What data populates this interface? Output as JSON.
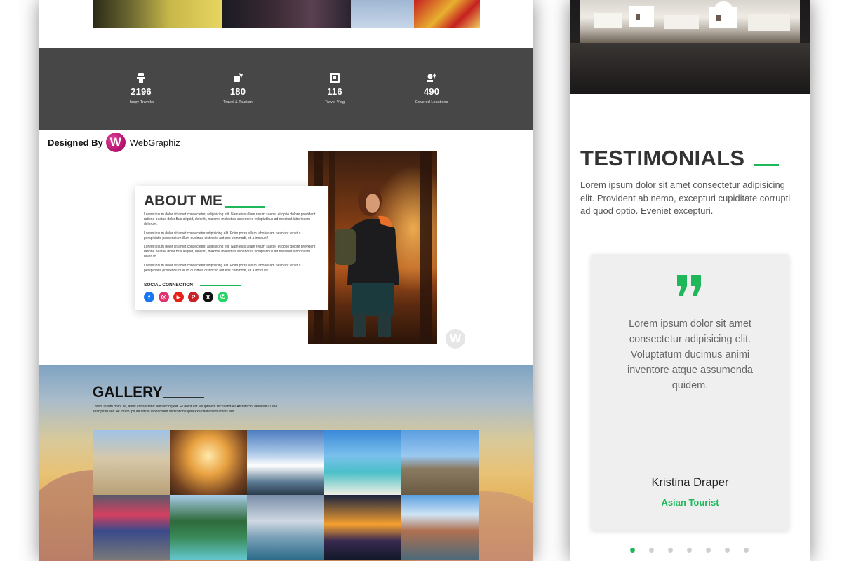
{
  "stats": [
    {
      "icon": "traveler-icon",
      "value": "2196",
      "label": "Happy Traveler"
    },
    {
      "icon": "tourism-icon",
      "value": "180",
      "label": "Travel & Tourism"
    },
    {
      "icon": "vlog-icon",
      "value": "116",
      "label": "Travel Vlog"
    },
    {
      "icon": "location-icon",
      "value": "490",
      "label": "Covered Locations"
    }
  ],
  "credit": {
    "prefix": "Designed By",
    "brand": "WebGraphiz",
    "logo_letter": "W"
  },
  "about": {
    "title": "ABOUT ME",
    "paragraphs": [
      "Lorem ipsum dolor sit amet consectetur, adipisicing elit. Nam eius ullam rerum saepe, et optio dolore provident ratione beatae dolor.Bus aliquid, deleniti, maxime molestias asperiores voluptatibus ad nesciunt laboriosam dolorum.",
      "Lorem ipsum dolor sit amet consectetur adipisicing elit. Enim porro ullam laboriosam nesciunt tenetur perspiciatis possendium illum ducimus distinctio aut eos commodi, sit a incidunt!",
      "Lorem ipsum dolor sit amet consectetur, adipisicing elit. Nam eius ullam rerum saepe, et optio dolore provident ratione beatae dolor.Bus aliquid, deleniti, maxime molestias asperiores voluptatibus ad nesciunt laboriosam dolorum.",
      "Lorem ipsum dolor sit amet consectetur adipisicing elit. Enim porro ullam laboriosam nesciunt tenetur perspiciatis possendium illum ducimus distinctio aut eos commodi, sit a incidunt!"
    ],
    "social_title": "SOCIAL CONNECTION",
    "social": [
      {
        "name": "facebook-icon",
        "glyph": "f",
        "color": "#1877f2"
      },
      {
        "name": "instagram-icon",
        "glyph": "◎",
        "color": "#e1306c"
      },
      {
        "name": "youtube-icon",
        "glyph": "▶",
        "color": "#e62117"
      },
      {
        "name": "pinterest-icon",
        "glyph": "P",
        "color": "#cb2027"
      },
      {
        "name": "x-icon",
        "glyph": "X",
        "color": "#111111"
      },
      {
        "name": "whatsapp-icon",
        "glyph": "✆",
        "color": "#25d366"
      }
    ],
    "watermark_letter": "W"
  },
  "gallery": {
    "title": "GALLERY",
    "description": "Lorem ipsum dolor sit, amet consectetur adipisicing elit. Et dolor est voluptatem recusandae! Architecto, laborum? Odio suscipit id sed. At totam ipsum officia laboriosam sed ratione ipsa exercitationem omnis ami."
  },
  "testimonials": {
    "title": "TESTIMONIALS",
    "description": "Lorem ipsum dolor sit amet consectetur adipisicing elit. Provident ab nemo, excepturi cupiditate corrupti ad quod optio. Eveniet excepturi.",
    "quote": "Lorem ipsum dolor sit amet consectetur adipisicing elit. Voluptatum ducimus animi inventore atque assumenda quidem.",
    "name": "Kristina Draper",
    "role": "Asian Tourist",
    "active_dot": 1,
    "dot_count": 7
  },
  "colors": {
    "accent": "#1eb85a",
    "stats_bg": "#474747",
    "brand": "#c01878"
  }
}
